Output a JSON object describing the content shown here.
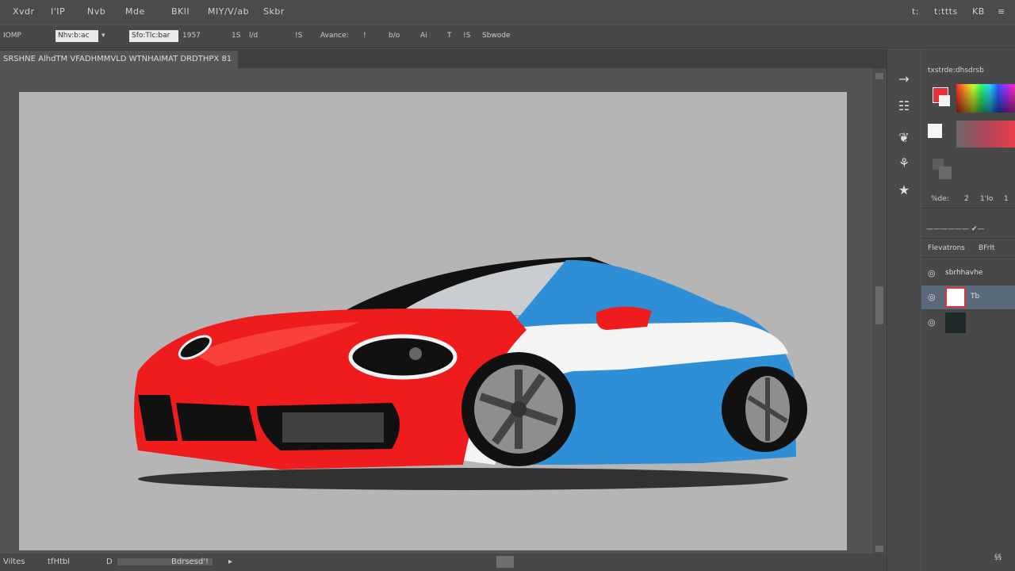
{
  "menubar": {
    "items": [
      "Xvdr",
      "I'IP",
      "Nvb",
      "Mde",
      "BKlI",
      "MIY/V/ab",
      "Skbr"
    ],
    "right_items": [
      "t:",
      "t:ttts",
      "KB",
      "≡"
    ]
  },
  "options": {
    "mode_label": "IOMP",
    "field1": "Nhv:b:ac",
    "field1_arrow": "▾",
    "field2": "Sfo:Tlc:bar",
    "items": [
      "1957",
      "1S",
      "l/d",
      "!S",
      "Avance:",
      "!",
      "b/o",
      "Ai",
      "T",
      "!S",
      "Sbwode"
    ]
  },
  "tab": {
    "title": "SRSHNE AlhdTM VFADHMMVLD WTNHAIMAT DRDTHPX 81"
  },
  "tools": [
    "→",
    "☷",
    "❦",
    "⚘",
    "★"
  ],
  "panels": {
    "color_title": "txstrde:dhsdrsb",
    "color_values": [
      "%de:",
      "2́",
      "1'Io",
      "1"
    ],
    "adjust_label": "—————— ✔—",
    "layers_tabs": [
      "Flevatrons",
      "BFrIt"
    ],
    "layers": [
      {
        "name": "sbrhhavhe",
        "thumb": "#5a5a5a"
      },
      {
        "name": "Tb",
        "thumb": "#ffffff"
      },
      {
        "name": "",
        "thumb": "#1e2a2a"
      }
    ]
  },
  "status": {
    "zoom": "Viltes",
    "info": "tfHtbl",
    "doc_label": "D",
    "doc_value": "Bdrsesd'!",
    "arrow": "▸",
    "right_icon": "§§"
  },
  "colors": {
    "car_red": "#ee1c1c",
    "car_blue": "#2f8fd6",
    "car_white": "#f4f4f4",
    "canvas_bg": "#b5b5b5"
  }
}
